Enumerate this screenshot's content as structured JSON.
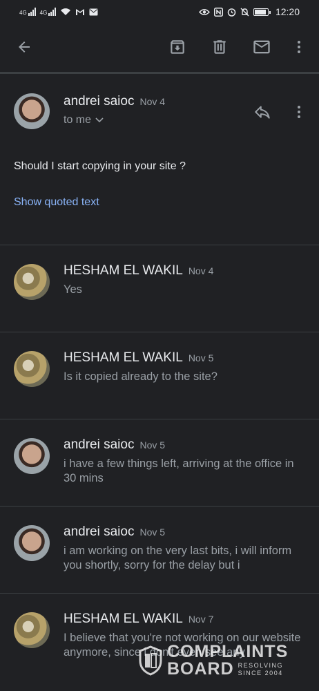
{
  "status_bar": {
    "signal1_label": "4G",
    "signal2_label": "4G",
    "time": "12:20"
  },
  "toolbar": {
    "icons": [
      "back-arrow-icon",
      "archive-icon",
      "delete-icon",
      "mail-icon",
      "more-vert-icon"
    ]
  },
  "first_message": {
    "sender": "andrei saioc",
    "date": "Nov 4",
    "recipient": "to me",
    "body": "Should I start copying in your site ?",
    "quoted_link": "Show quoted text"
  },
  "thread": [
    {
      "sender": "HESHAM EL WAKIL",
      "date": "Nov 4",
      "snippet": "Yes",
      "avatar": "hesham"
    },
    {
      "sender": "HESHAM EL WAKIL",
      "date": "Nov 5",
      "snippet": "Is it copied already to the site?",
      "avatar": "hesham"
    },
    {
      "sender": "andrei saioc",
      "date": "Nov 5",
      "snippet": "i have a few things left, arriving at the office in 30 mins",
      "avatar": "andrei"
    },
    {
      "sender": "andrei saioc",
      "date": "Nov 5",
      "snippet": "i am working on the very last bits, i will inform you shortly, sorry for the delay but i",
      "avatar": "andrei"
    },
    {
      "sender": "HESHAM EL WAKIL",
      "date": "Nov 7",
      "snippet": "I believe that you're not working on our website anymore, since i don't even see any",
      "avatar": "hesham"
    }
  ],
  "watermark": {
    "line1": "COMPLAINTS",
    "line2": "BOARD",
    "tagline1": "RESOLVING",
    "tagline2": "SINCE 2004"
  },
  "colors": {
    "background": "#202124",
    "text_primary": "#e8eaed",
    "text_secondary": "#9aa0a6",
    "link": "#8ab4f8",
    "divider": "#3c4043"
  }
}
